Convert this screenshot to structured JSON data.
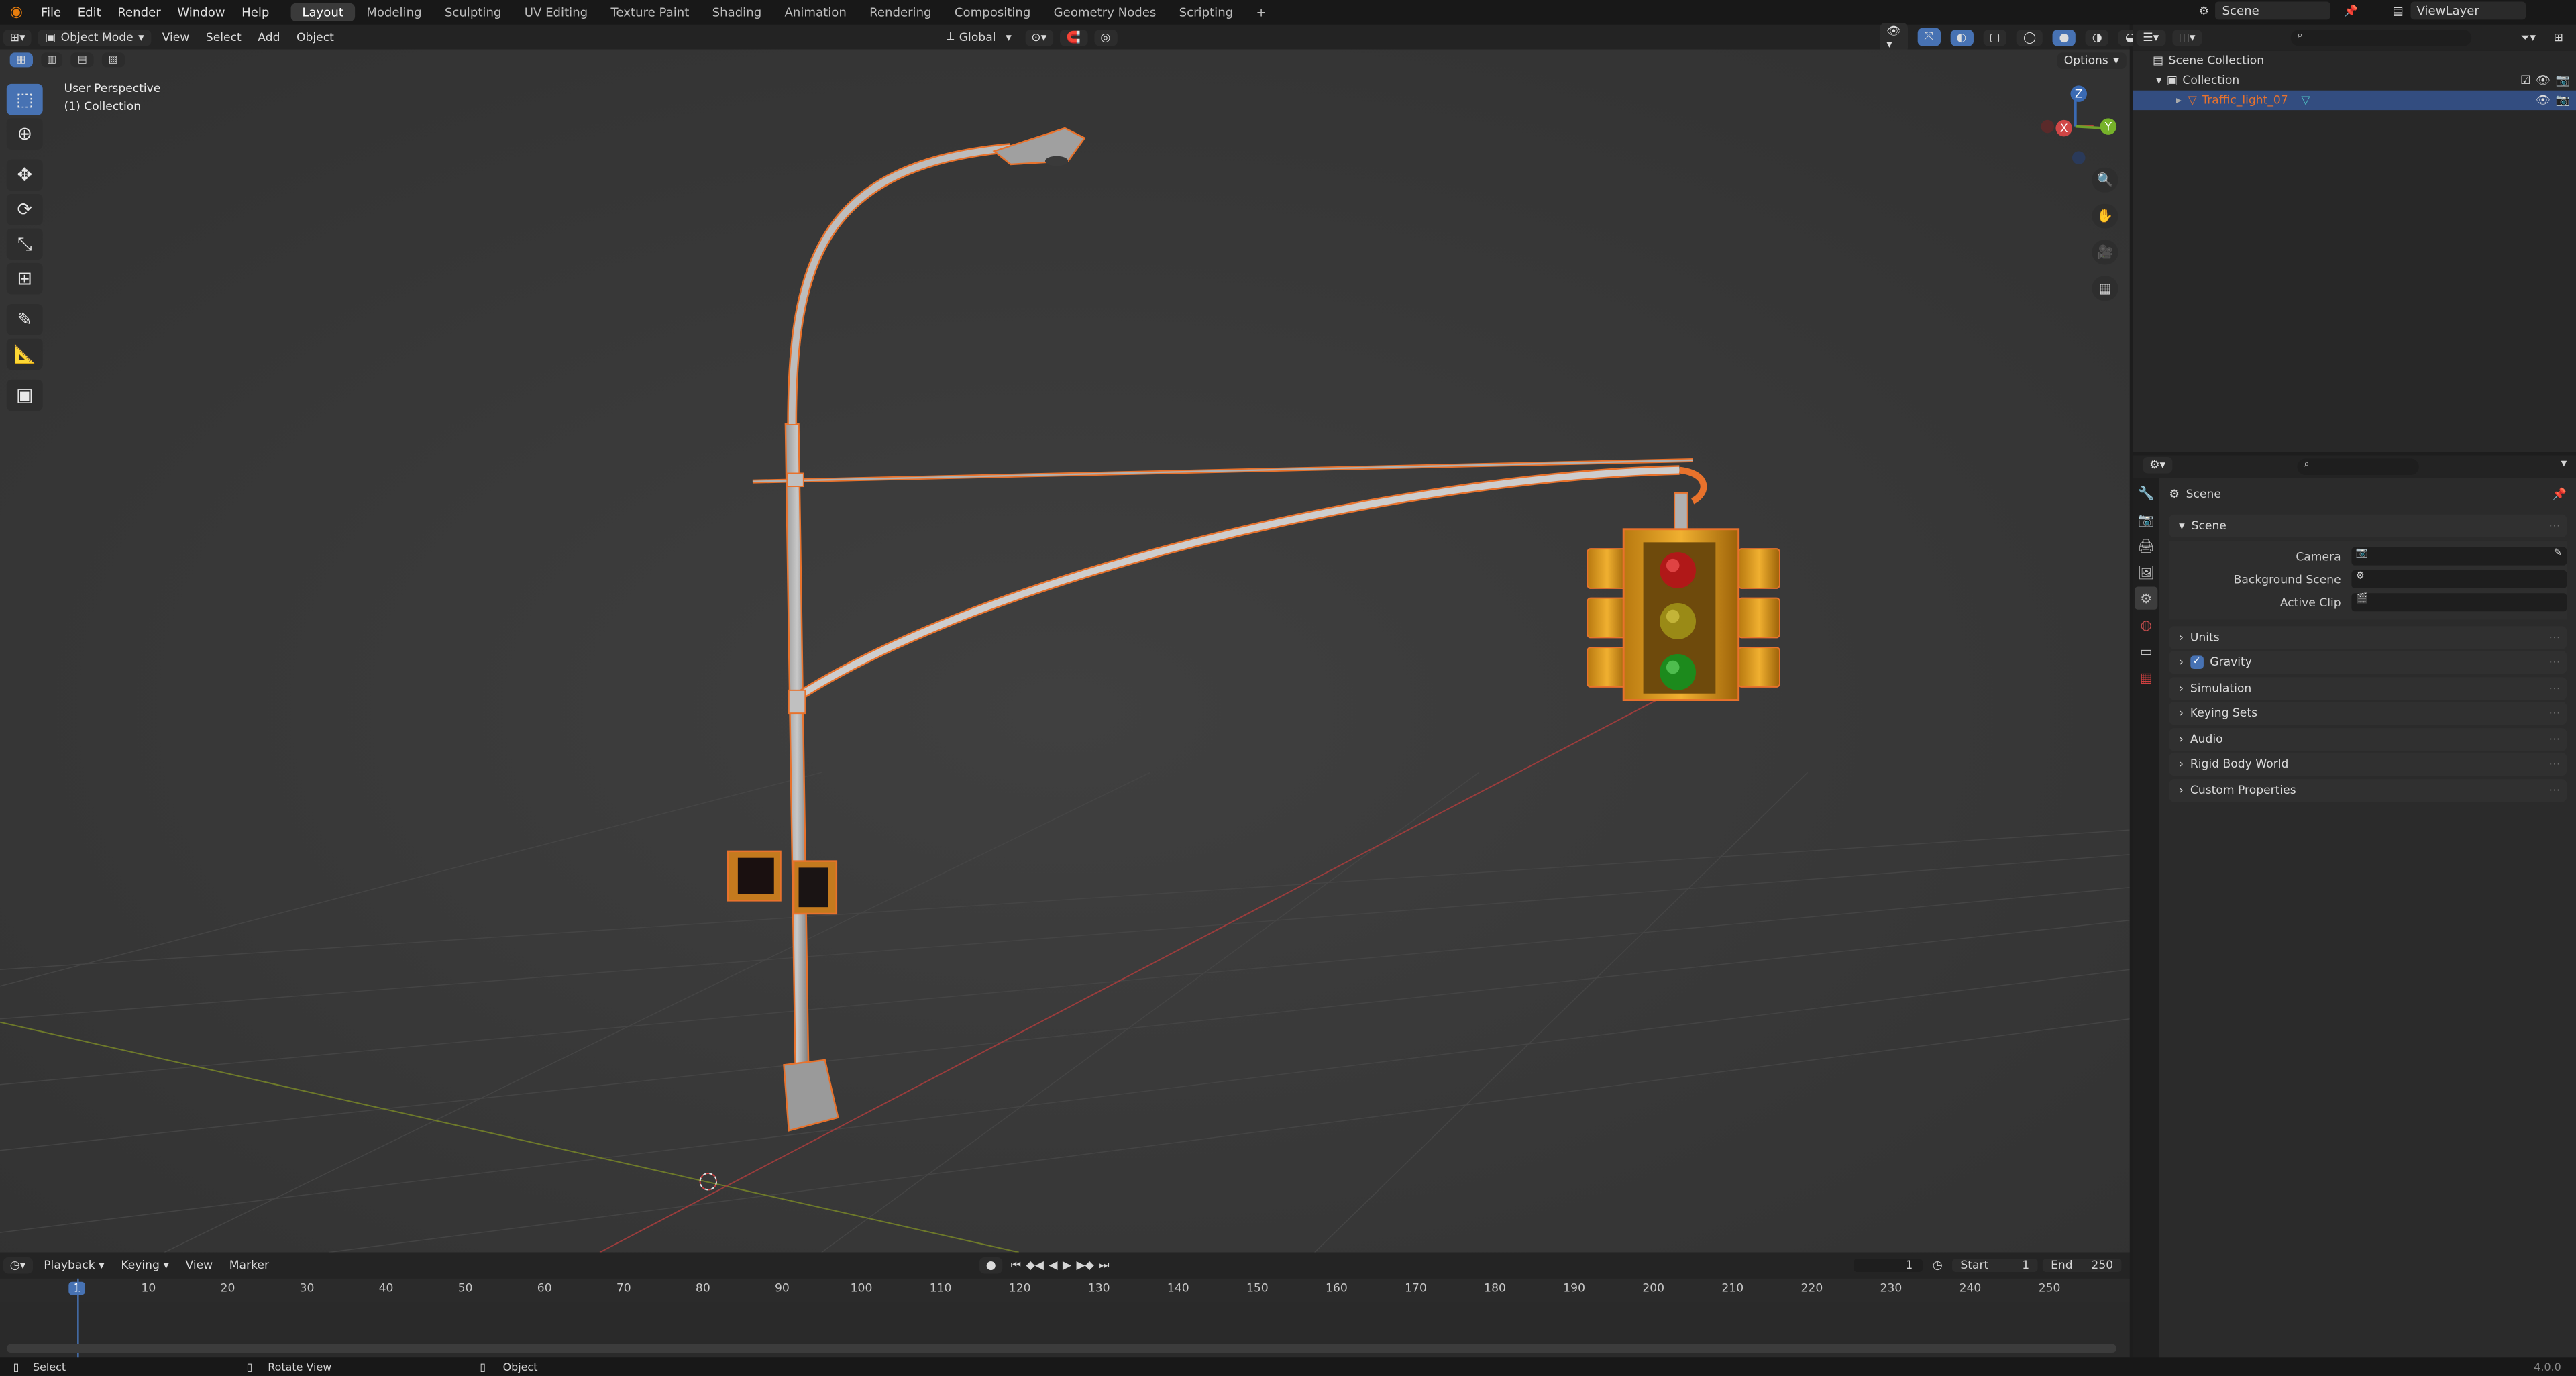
{
  "menubar": {
    "items": [
      "File",
      "Edit",
      "Render",
      "Window",
      "Help"
    ],
    "workspaces": [
      "Layout",
      "Modeling",
      "Sculpting",
      "UV Editing",
      "Texture Paint",
      "Shading",
      "Animation",
      "Rendering",
      "Compositing",
      "Geometry Nodes",
      "Scripting"
    ],
    "active_workspace": "Layout",
    "add_tab": "+",
    "scene": "Scene",
    "view_layer": "ViewLayer"
  },
  "viewport_header": {
    "mode": "Object Mode",
    "menus": [
      "View",
      "Select",
      "Add",
      "Object"
    ],
    "orientation": "Global",
    "options": "Options"
  },
  "viewport": {
    "perspective": "User Perspective",
    "collection": "(1) Collection"
  },
  "gizmo": {
    "x": "X",
    "y": "Y",
    "z": "Z"
  },
  "outliner": {
    "rows": [
      {
        "label": "Scene Collection"
      },
      {
        "label": "Collection"
      },
      {
        "label": "Traffic_light_07"
      }
    ]
  },
  "properties": {
    "context": "Scene",
    "panel": "Scene",
    "fields": [
      {
        "label": "Camera"
      },
      {
        "label": "Background Scene"
      },
      {
        "label": "Active Clip"
      }
    ],
    "panels": [
      "Units",
      "Gravity",
      "Simulation",
      "Keying Sets",
      "Audio",
      "Rigid Body World",
      "Custom Properties"
    ]
  },
  "timeline": {
    "menus": [
      "Playback",
      "Keying",
      "View",
      "Marker"
    ],
    "current_frame": "1",
    "start_label": "Start",
    "start": "1",
    "end_label": "End",
    "end": "250",
    "ticks": [
      "1",
      "10",
      "20",
      "30",
      "40",
      "50",
      "60",
      "70",
      "80",
      "90",
      "100",
      "110",
      "120",
      "130",
      "140",
      "150",
      "160",
      "170",
      "180",
      "190",
      "200",
      "210",
      "220",
      "230",
      "240",
      "250"
    ]
  },
  "statusbar": {
    "items": [
      "Select",
      "Rotate View",
      "Object"
    ],
    "version": "4.0.0"
  },
  "colors": {
    "accent": "#4772b3",
    "selection": "#e8722c",
    "bg": "#3a3a3a"
  }
}
